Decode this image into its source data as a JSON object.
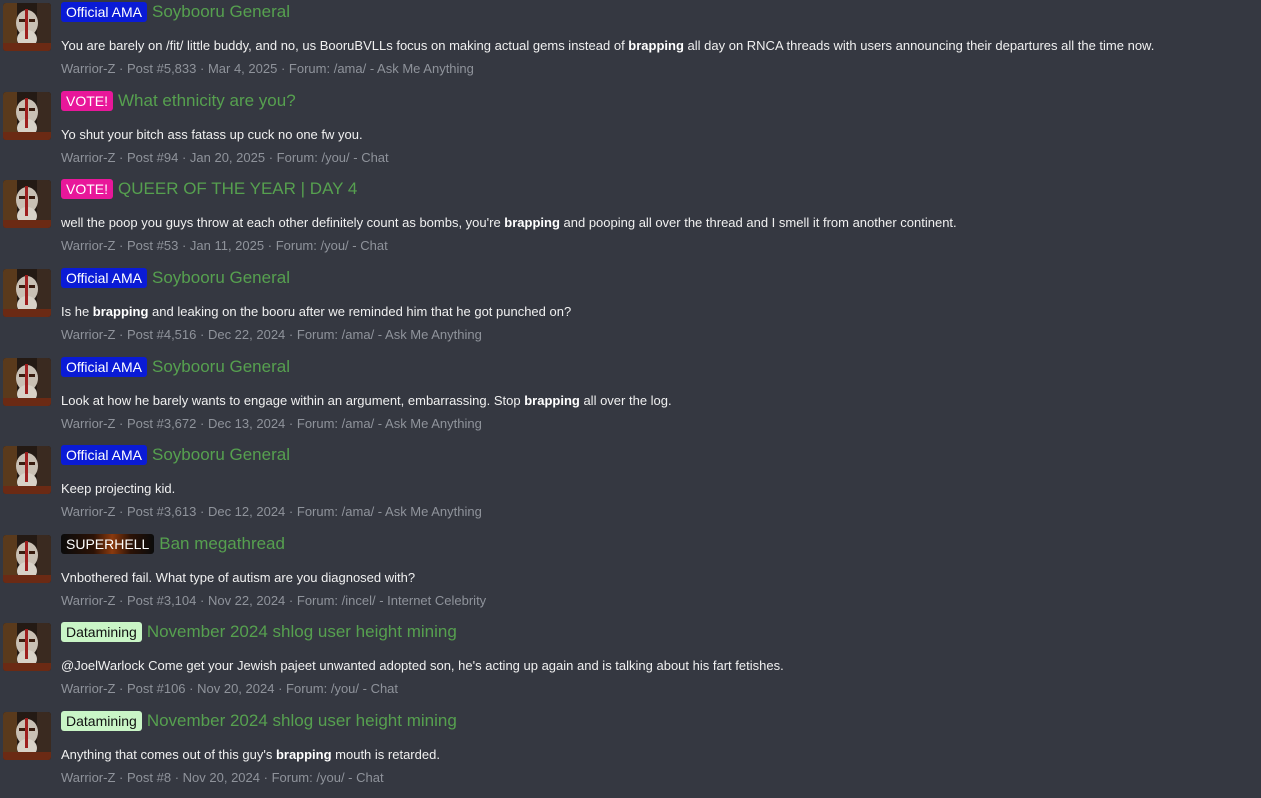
{
  "colors": {
    "background": "#353841",
    "thread_title": "#56a04f",
    "meta_text": "#8f939b",
    "prefix_official_ama": "#0a1bd6",
    "prefix_vote": "#e8179a",
    "prefix_datamining": "#c9f5c6",
    "prefix_superhell": "#2b1206"
  },
  "results": [
    {
      "prefix": "Official AMA",
      "prefix_style": "ama",
      "title": "Soybooru General",
      "snippet": [
        {
          "text": "You are barely on /fit/ little buddy, and no, us BooruBVLLs focus on making actual gems instead of "
        },
        {
          "text": "brapping",
          "bold": true
        },
        {
          "text": " all day on RNCA threads with users announcing their departures all the time now."
        }
      ],
      "author": "Warrior-Z",
      "post": "Post #5,833",
      "date": "Mar 4, 2025",
      "forum_label": "Forum:",
      "forum": "/ama/ - Ask Me Anything"
    },
    {
      "prefix": "VOTE!",
      "prefix_style": "vote",
      "title": "What ethnicity are you?",
      "snippet": [
        {
          "text": "Yo shut your bitch ass fatass up cuck no one fw you."
        }
      ],
      "author": "Warrior-Z",
      "post": "Post #94",
      "date": "Jan 20, 2025",
      "forum_label": "Forum:",
      "forum": "/you/ - Chat"
    },
    {
      "prefix": "VOTE!",
      "prefix_style": "vote",
      "title": "QUEER OF THE YEAR | DAY 4",
      "snippet": [
        {
          "text": "well the poop you guys throw at each other definitely count as bombs, you're "
        },
        {
          "text": "brapping",
          "bold": true
        },
        {
          "text": " and pooping all over the thread and I smell it from another continent."
        }
      ],
      "author": "Warrior-Z",
      "post": "Post #53",
      "date": "Jan 11, 2025",
      "forum_label": "Forum:",
      "forum": "/you/ - Chat"
    },
    {
      "prefix": "Official AMA",
      "prefix_style": "ama",
      "title": "Soybooru General",
      "snippet": [
        {
          "text": "Is he "
        },
        {
          "text": "brapping",
          "bold": true
        },
        {
          "text": " and leaking on the booru after we reminded him that he got punched on?"
        }
      ],
      "author": "Warrior-Z",
      "post": "Post #4,516",
      "date": "Dec 22, 2024",
      "forum_label": "Forum:",
      "forum": "/ama/ - Ask Me Anything"
    },
    {
      "prefix": "Official AMA",
      "prefix_style": "ama",
      "title": "Soybooru General",
      "snippet": [
        {
          "text": "Look at how he barely wants to engage within an argument, embarrassing. Stop "
        },
        {
          "text": "brapping",
          "bold": true
        },
        {
          "text": " all over the log."
        }
      ],
      "author": "Warrior-Z",
      "post": "Post #3,672",
      "date": "Dec 13, 2024",
      "forum_label": "Forum:",
      "forum": "/ama/ - Ask Me Anything"
    },
    {
      "prefix": "Official AMA",
      "prefix_style": "ama",
      "title": "Soybooru General",
      "snippet": [
        {
          "text": "Keep projecting kid."
        }
      ],
      "author": "Warrior-Z",
      "post": "Post #3,613",
      "date": "Dec 12, 2024",
      "forum_label": "Forum:",
      "forum": "/ama/ - Ask Me Anything"
    },
    {
      "prefix": "SUPERHELL",
      "prefix_style": "superhell",
      "title": "Ban megathread",
      "snippet": [
        {
          "text": "Vnbothered fail. What type of autism are you diagnosed with?"
        }
      ],
      "author": "Warrior-Z",
      "post": "Post #3,104",
      "date": "Nov 22, 2024",
      "forum_label": "Forum:",
      "forum": "/incel/ - Internet Celebrity"
    },
    {
      "prefix": "Datamining",
      "prefix_style": "data",
      "title": "November 2024 shlog user height mining",
      "snippet": [
        {
          "text": "@JoelWarlock Come get your Jewish pajeet unwanted adopted son, he's acting up again and is talking about his fart fetishes."
        }
      ],
      "author": "Warrior-Z",
      "post": "Post #106",
      "date": "Nov 20, 2024",
      "forum_label": "Forum:",
      "forum": "/you/ - Chat"
    },
    {
      "prefix": "Datamining",
      "prefix_style": "data",
      "title": "November 2024 shlog user height mining",
      "snippet": [
        {
          "text": "Anything that comes out of this guy's "
        },
        {
          "text": "brapping",
          "bold": true
        },
        {
          "text": " mouth is retarded."
        }
      ],
      "author": "Warrior-Z",
      "post": "Post #8",
      "date": "Nov 20, 2024",
      "forum_label": "Forum:",
      "forum": "/you/ - Chat"
    }
  ]
}
